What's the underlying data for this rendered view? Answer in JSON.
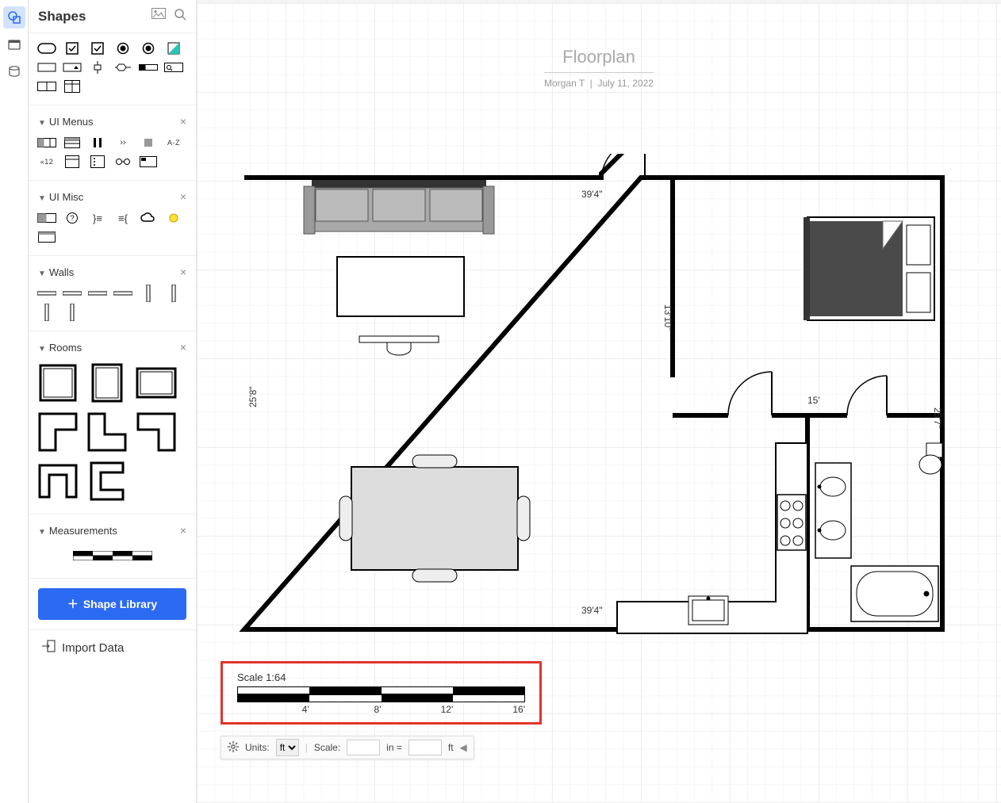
{
  "sidebar_title": "Shapes",
  "sections": {
    "ui_menus": "UI Menus",
    "ui_misc": "UI Misc",
    "walls": "Walls",
    "rooms": "Rooms",
    "measurements": "Measurements"
  },
  "badges": {
    "sort": "A-Z",
    "lt12": "«12"
  },
  "shape_library_btn": "Shape Library",
  "import_data": "Import Data",
  "page": {
    "title": "Floorplan",
    "author": "Morgan T",
    "date": "July 11, 2022"
  },
  "floorplan": {
    "dims": {
      "top_width": "39'4\"",
      "bottom_width": "39'4\"",
      "left_height": "25'8\"",
      "inner_height": "13'10\"",
      "bedroom_hall": "15'",
      "bath_height": "25'7\""
    }
  },
  "scale": {
    "label": "Scale 1:64",
    "ticks": [
      "4'",
      "8'",
      "12'",
      "16'"
    ]
  },
  "bottombar": {
    "units_label": "Units:",
    "units_value": "ft",
    "scale_label": "Scale:",
    "equals": "in =",
    "ft_suffix": "ft"
  }
}
